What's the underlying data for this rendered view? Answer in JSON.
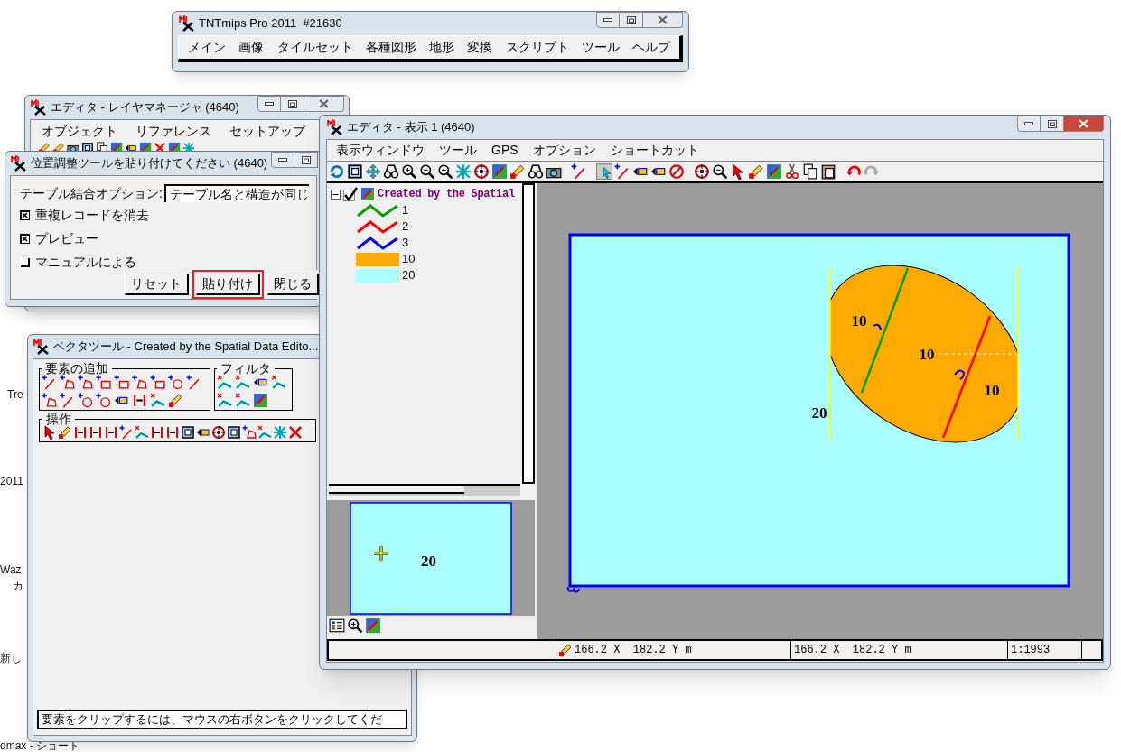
{
  "desktop": {
    "icon_labels": [
      "Tre",
      "2011",
      "Waz",
      "カ",
      "新し",
      "dmax - ショート"
    ]
  },
  "main_window": {
    "title": "TNTmips Pro 2011  #21630",
    "menu": [
      "メイン",
      "画像",
      "タイルセット",
      "各種図形",
      "地形",
      "変換",
      "スクリプト",
      "ツール",
      "ヘルプ"
    ]
  },
  "layer_manager": {
    "title": "エディタ - レイヤマネージャ (4640)",
    "menu": [
      "オブジェクト",
      "リファレンス",
      "セットアップ"
    ]
  },
  "paste_dialog": {
    "title": "位置調整ツールを貼り付けてください (4640)",
    "join_option": {
      "label": "テーブル結合オプション:",
      "value": "テーブル名と構造が同じ"
    },
    "options": [
      {
        "label": "重複レコードを消去",
        "checked": true
      },
      {
        "label": "プレビュー",
        "checked": true
      },
      {
        "label": "マニュアルによる",
        "checked": false
      }
    ],
    "buttons": [
      {
        "label": "リセット",
        "highlighted": false
      },
      {
        "label": "貼り付け",
        "highlighted": true
      },
      {
        "label": "閉じる",
        "highlighted": false
      }
    ]
  },
  "vector_tools": {
    "title": "ベクタツール - Created by the Spatial Data Edito...",
    "groups": [
      {
        "title": "要素の追加"
      },
      {
        "title": "フィルタ"
      },
      {
        "title": "操作"
      }
    ],
    "status": "要素をクリップするには、マウスの右ボタンをクリックしてくだ"
  },
  "editor": {
    "title": "エディタ - 表示 1 (4640)",
    "menu": [
      "表示ウィンドウ",
      "ツール",
      "GPS",
      "オプション",
      "ショートカット"
    ],
    "layer": {
      "label": "Created by the Spatial",
      "checked": true,
      "expanded": true,
      "children": [
        {
          "label": "1",
          "kind": "line",
          "color": "#00a000"
        },
        {
          "label": "2",
          "kind": "line",
          "color": "#ff0000"
        },
        {
          "label": "3",
          "kind": "line",
          "color": "#0000ff"
        },
        {
          "label": "10",
          "kind": "fill",
          "color": "#ffaa00"
        },
        {
          "label": "20",
          "kind": "fill",
          "color": "#aaffff"
        }
      ]
    },
    "overview_label": "20",
    "map_labels": [
      "10",
      "10",
      "10",
      "20"
    ],
    "status_bar": {
      "position": "166.2 X  182.2 Y m",
      "cursor": "166.2 X  182.2 Y m",
      "scale": "1:1993"
    }
  }
}
